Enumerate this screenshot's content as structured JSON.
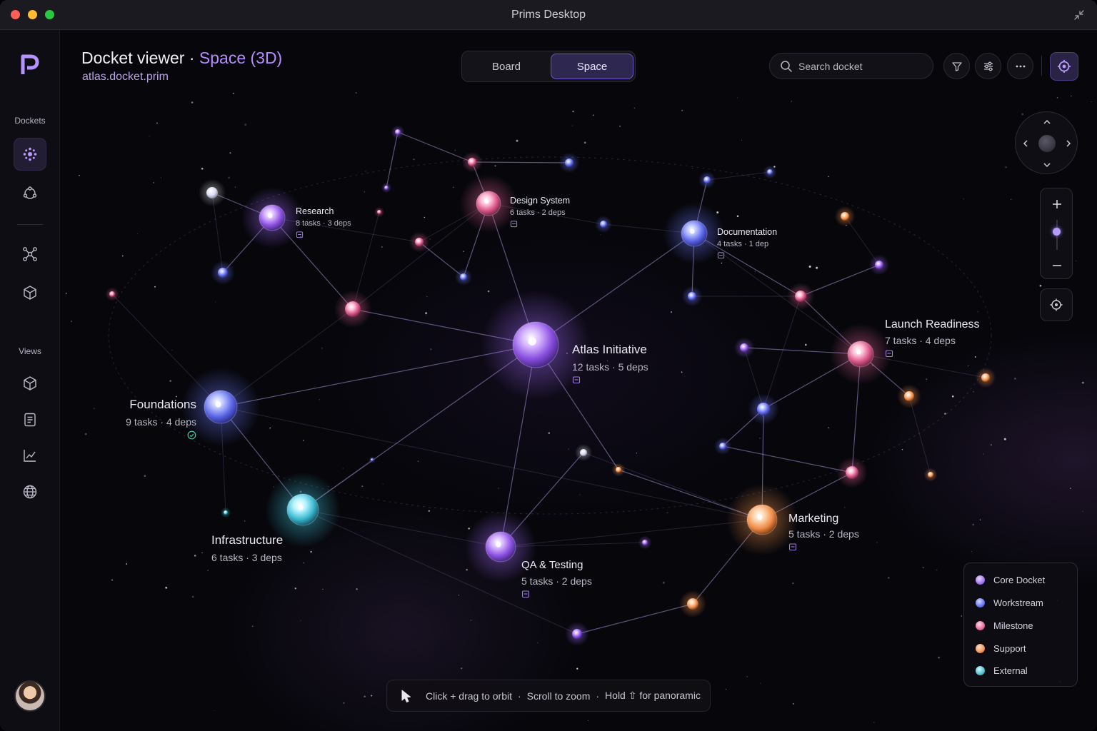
{
  "window": {
    "title": "Prims Desktop"
  },
  "sidebar": {
    "dockets_label": "Dockets",
    "views_label": "Views",
    "items": [
      {
        "icon": "constellation-icon",
        "active": true
      },
      {
        "icon": "orbit-icon"
      },
      {
        "icon": "network-icon"
      },
      {
        "icon": "cube-outline-icon"
      },
      {
        "icon": "box-3d-icon"
      },
      {
        "icon": "document-icon"
      },
      {
        "icon": "chart-icon"
      },
      {
        "icon": "globe-icon"
      }
    ]
  },
  "header": {
    "title": "Docket viewer",
    "separator": "·",
    "mode": "Space (3D)",
    "subtitle": "atlas.docket.prim",
    "tabs": {
      "board": "Board",
      "space": "Space"
    },
    "search_placeholder": "Search docket"
  },
  "nodes": {
    "atlas": {
      "name": "Atlas Initiative",
      "meta": "12 tasks · 5 deps"
    },
    "foundations": {
      "name": "Foundations",
      "meta": "9 tasks · 4 deps"
    },
    "infrastructure": {
      "name": "Infrastructure",
      "meta": "6 tasks · 3 deps"
    },
    "qa": {
      "name": "QA & Testing",
      "meta": "5 tasks · 2 deps"
    },
    "marketing": {
      "name": "Marketing",
      "meta": "5 tasks · 2 deps"
    },
    "launch": {
      "name": "Launch Readiness",
      "meta": "7 tasks · 4 deps"
    },
    "documentation": {
      "name": "Documentation",
      "meta": "4 tasks · 1 dep"
    },
    "design": {
      "name": "Design System",
      "meta": "6 tasks · 2 deps"
    },
    "research": {
      "name": "Research",
      "meta": "8 tasks · 3 deps"
    }
  },
  "legend": {
    "items": [
      {
        "label": "Core Docket",
        "color": "#a97cf2"
      },
      {
        "label": "Workstream",
        "color": "#6e7cf5"
      },
      {
        "label": "Milestone",
        "color": "#e9749f"
      },
      {
        "label": "Support",
        "color": "#f39a62"
      },
      {
        "label": "External",
        "color": "#5cc7d6"
      }
    ]
  },
  "hint": {
    "orbit": "Click + drag to orbit",
    "dot1": "·",
    "zoom": "Scroll to zoom",
    "dot2": "·",
    "panoramic": "Hold ⇧ for panoramic"
  }
}
